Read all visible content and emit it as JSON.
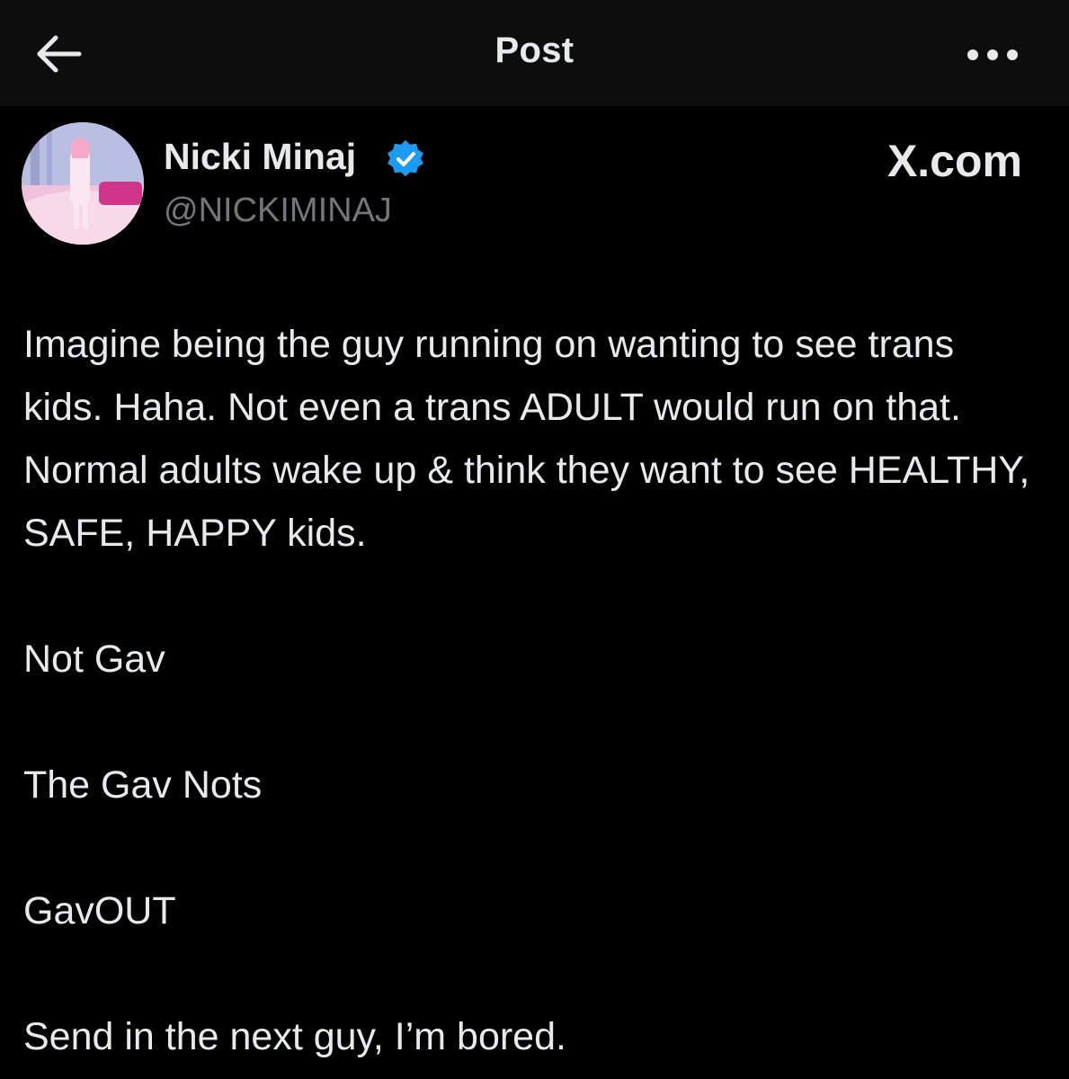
{
  "header": {
    "title": "Post",
    "back_icon": "arrow-left-icon",
    "more_icon": "more-horizontal-icon"
  },
  "post": {
    "author": {
      "display_name": "Nicki Minaj",
      "handle": "@NICKIMINAJ",
      "verified": true,
      "badge_color": "#1d9bf0",
      "avatar_icon": "profile-photo"
    },
    "source_label": "X.com",
    "paragraphs": [
      "Imagine being the guy running on wanting to see trans kids. Haha. Not even a trans ADULT would run on that. Normal adults wake up & think they want to see HEALTHY, SAFE, HAPPY kids.",
      "Not Gav",
      "The Gav Nots",
      "GavOUT",
      "Send in the next guy, I’m bored."
    ]
  },
  "colors": {
    "background": "#000000",
    "header_background": "#0d0d0d",
    "primary_text": "#e7e9ea",
    "secondary_text": "#71767b",
    "verified_blue": "#1d9bf0"
  }
}
